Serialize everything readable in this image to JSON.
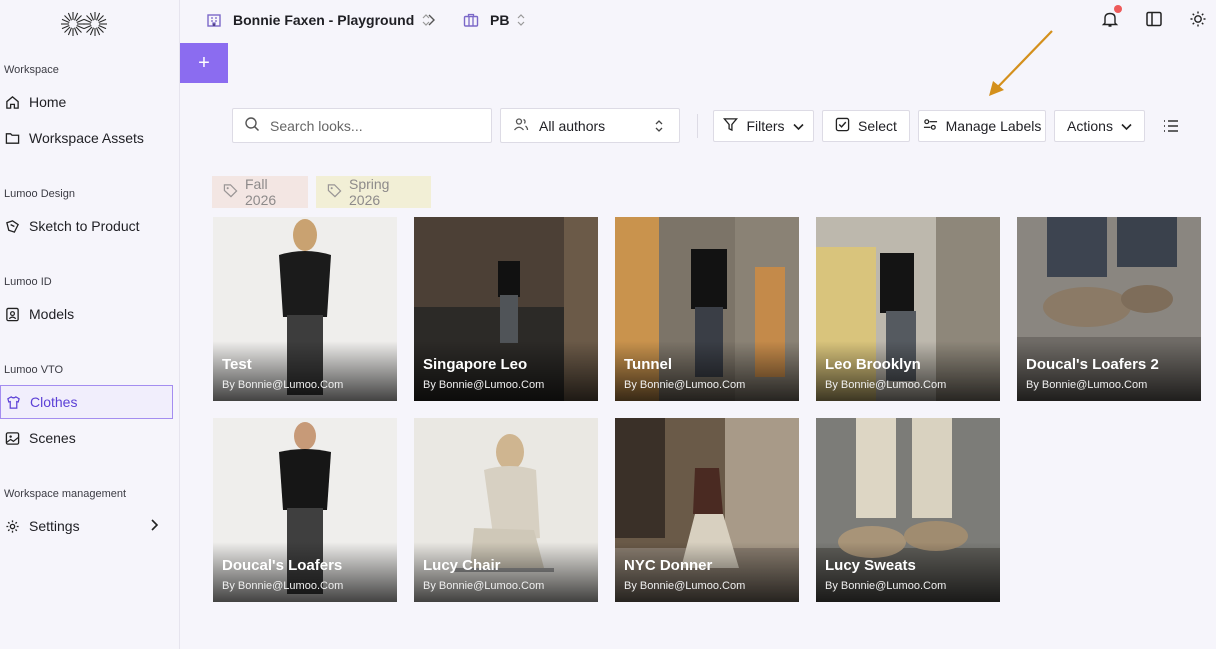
{
  "sidebar": {
    "sections": [
      {
        "label": "Workspace",
        "items": [
          {
            "label": "Home",
            "icon": "home-icon"
          },
          {
            "label": "Workspace Assets",
            "icon": "folder-icon"
          }
        ]
      },
      {
        "label": "Lumoo Design",
        "items": [
          {
            "label": "Sketch to Product",
            "icon": "sketch-icon"
          }
        ]
      },
      {
        "label": "Lumoo ID",
        "items": [
          {
            "label": "Models",
            "icon": "id-card-icon"
          }
        ]
      },
      {
        "label": "Lumoo VTO",
        "items": [
          {
            "label": "Clothes",
            "icon": "shirt-icon",
            "active": true
          },
          {
            "label": "Scenes",
            "icon": "image-icon"
          }
        ]
      },
      {
        "label": "Workspace management",
        "items": [
          {
            "label": "Settings",
            "icon": "gear-icon"
          }
        ]
      }
    ]
  },
  "topbar": {
    "workspace": "Bonnie Faxen - Playground",
    "project": "PB"
  },
  "add_button_label": "+",
  "toolbar": {
    "search_placeholder": "Search looks...",
    "authors_label": "All authors",
    "filters_label": "Filters",
    "select_label": "Select",
    "manage_labels_label": "Manage Labels",
    "actions_label": "Actions"
  },
  "labels": [
    "Fall 2026",
    "Spring 2026"
  ],
  "looks": [
    {
      "title": "Test",
      "author": "By Bonnie@Lumoo.Com"
    },
    {
      "title": "Singapore Leo",
      "author": "By Bonnie@Lumoo.Com"
    },
    {
      "title": "Tunnel",
      "author": "By Bonnie@Lumoo.Com"
    },
    {
      "title": "Leo Brooklyn",
      "author": "By Bonnie@Lumoo.Com"
    },
    {
      "title": "Doucal's Loafers 2",
      "author": "By Bonnie@Lumoo.Com"
    },
    {
      "title": "Doucal's Loafers",
      "author": "By Bonnie@Lumoo.Com"
    },
    {
      "title": "Lucy Chair",
      "author": "By Bonnie@Lumoo.Com"
    },
    {
      "title": "NYC Donner",
      "author": "By Bonnie@Lumoo.Com"
    },
    {
      "title": "Lucy Sweats",
      "author": "By Bonnie@Lumoo.Com"
    }
  ],
  "colors": {
    "accent": "#8b6cf0",
    "active_border": "#a48df0",
    "notification": "#ee5a5a",
    "annotation_arrow": "#d4901c"
  }
}
